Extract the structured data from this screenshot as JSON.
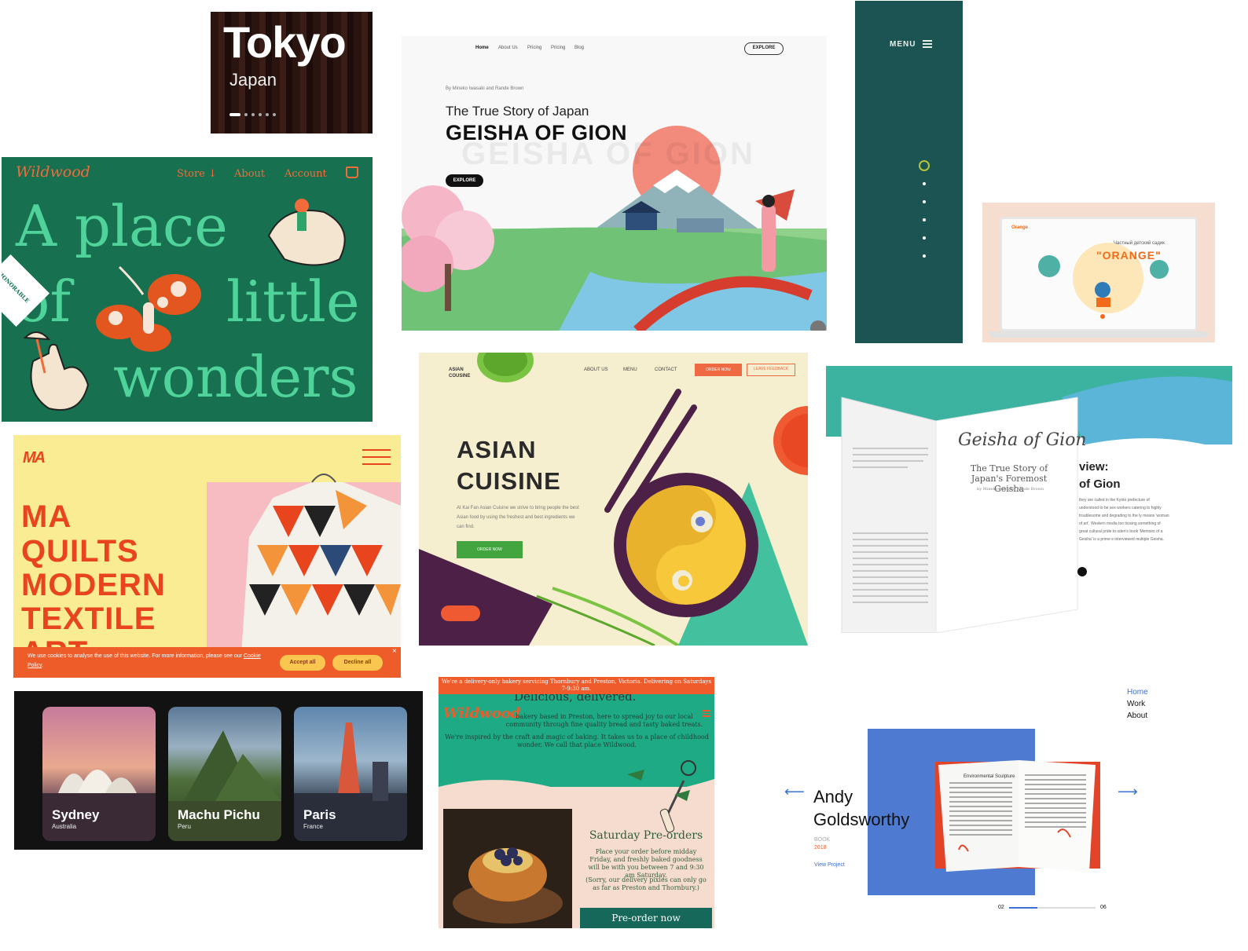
{
  "tokyo": {
    "city": "Tokyo",
    "country": "Japan",
    "slides": 6,
    "active_slide": 1
  },
  "wildwood": {
    "logo": "Wildwood",
    "nav": [
      "Store ↓",
      "About",
      "Account"
    ],
    "headline": [
      "A place",
      "of",
      "little",
      "wonders"
    ],
    "badge": [
      "HONORABLE",
      "MENTION"
    ],
    "colors": {
      "bg": "#17704f",
      "accent": "#f26b3a",
      "text": "#4fd39a"
    }
  },
  "geisha": {
    "nav": [
      "Home",
      "About Us",
      "Pricing",
      "Pricing",
      "Blog"
    ],
    "explore_top": "EXPLORE",
    "byline": "By Mineko Iwasaki and Rande Brown",
    "subtitle": "The True Story of Japan",
    "title": "GEISHA OF GION",
    "ghost": "GEISHA OF GION",
    "button": "EXPLORE"
  },
  "menu_panel": {
    "label": "MENU",
    "dots": 5,
    "colors": {
      "bg": "#1b5452",
      "ring": "#b4c53a"
    }
  },
  "orange": {
    "brand": "Orange",
    "subtitle": "Частный детский садик",
    "headline": "\"ORANGE\""
  },
  "quilts": {
    "logo": "MA",
    "headline": [
      "MA",
      "QUILTS",
      "MODERN",
      "TEXTILE",
      "ART"
    ],
    "cookie_text": "We use cookies to analyse the use of this website. For more information, please see our ",
    "cookie_link": "Cookie Policy",
    "cookie_text_end": ".",
    "accept": "Accept all",
    "decline": "Decline all",
    "close": "×"
  },
  "asian": {
    "logo": [
      "ASIAN",
      "COUSINE"
    ],
    "nav": [
      "ABOUT US",
      "MENU",
      "CONTACT"
    ],
    "order_now": "ORDER NOW",
    "feedback": "LEAVE FEEDBACK",
    "title": [
      "ASIAN",
      "CUISINE"
    ],
    "description": "At Kai Fan Asian Cuisine we strive to bring people the best Asian food by using the freshest and best ingredients we can find.",
    "cta": "ORDER NOW"
  },
  "book": {
    "title": "Geisha of Gion",
    "subtitle": "The True Story of Japan's Foremost Geisha",
    "authors": "by Mineko Iwasaki, Rande Brown",
    "review_heading": "view:",
    "review_title": "of Gion",
    "review_text": "they are called in the Kyoto prefecture of understood to be sex workers catering to highly troublesome and degrading to the ly means 'woman of art'. Western media too ticising something of great cultural pride to oden's book 'Memoirs of a Geisha' is a prime e interviewed multiple Geisha."
  },
  "destinations": [
    {
      "name": "Sydney",
      "country": "Australia"
    },
    {
      "name": "Machu Pichu",
      "country": "Peru"
    },
    {
      "name": "Paris",
      "country": "France"
    }
  ],
  "bakery": {
    "banner": "We're a delivery-only bakery servicing Thornbury and Preston, Victoria. Delivering on Saturdays 7-9:30 am.",
    "partial_heading": "Delicious, delivered.",
    "logo": "Wildwood",
    "p1": "bakery based in Preston, here to spread joy to our local community through fine quality bread and tasty baked treats.",
    "p2": "We're inspired by the craft and magic of baking. It takes us to a place of childhood wonder. We call that place Wildwood.",
    "preorder_heading": "Saturday Pre-orders",
    "preorder_text": "Place your order before midday Friday, and freshly baked goodness will be with you between 7 and 9:30 am Saturday.",
    "preorder_note": "(Sorry, our delivery pixies can only go as far as Preston and Thornbury.)",
    "preorder_button": "Pre-order now"
  },
  "andy": {
    "nav": [
      "Home",
      "Work",
      "About"
    ],
    "name_line1": "Andy",
    "name_line2": "Goldsworthy",
    "category": "BOOK",
    "year": "2018",
    "link": "View Project",
    "page_current": "02",
    "page_total": "06",
    "progress": 0.33,
    "book_heading": "Environmental Sculpture"
  }
}
